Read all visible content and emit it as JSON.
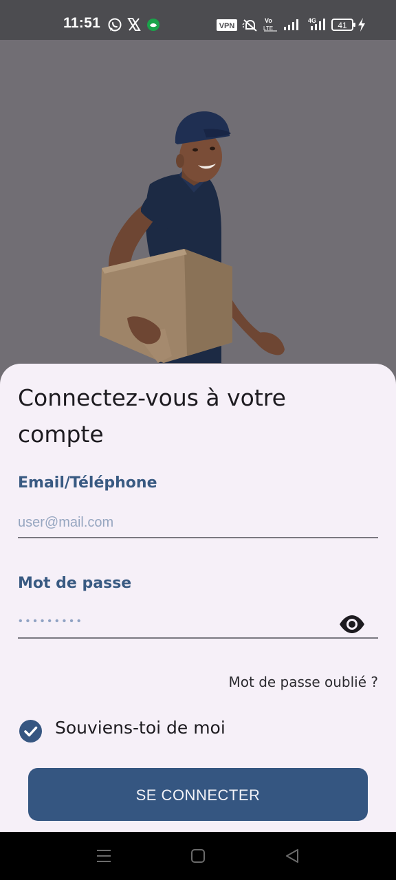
{
  "status_bar": {
    "time": "11:51",
    "vpn_badge": "VPN",
    "volte": "Vo\nLTE",
    "network": "4G",
    "battery": "41",
    "icons": [
      "whatsapp-icon",
      "x-icon",
      "app-notification-icon",
      "vpn-icon",
      "mute-icon",
      "volte-icon",
      "signal-icon",
      "signal-4g-icon",
      "battery-icon",
      "charging-icon"
    ]
  },
  "hero": {
    "image": "delivery-man-with-box-photo"
  },
  "login": {
    "title": "Connectez-vous à votre compte",
    "email_label": "Email/Téléphone",
    "email_placeholder": "user@mail.com",
    "email_value": "",
    "password_label": "Mot de passe",
    "password_masked": "•••••••••",
    "forgot_password": "Mot de passe oublié ?",
    "remember_me": "Souviens-toi de moi",
    "remember_me_checked": true,
    "submit": "SE CONNECTER"
  },
  "nav_bar": {
    "icons": [
      "menu-icon",
      "home-icon",
      "back-icon"
    ]
  },
  "colors": {
    "primary": "#355681",
    "label": "#395a82",
    "sheet_background": "#f6f0f8",
    "hero_background": "#716e74",
    "status_bar": "#4c4c50"
  }
}
